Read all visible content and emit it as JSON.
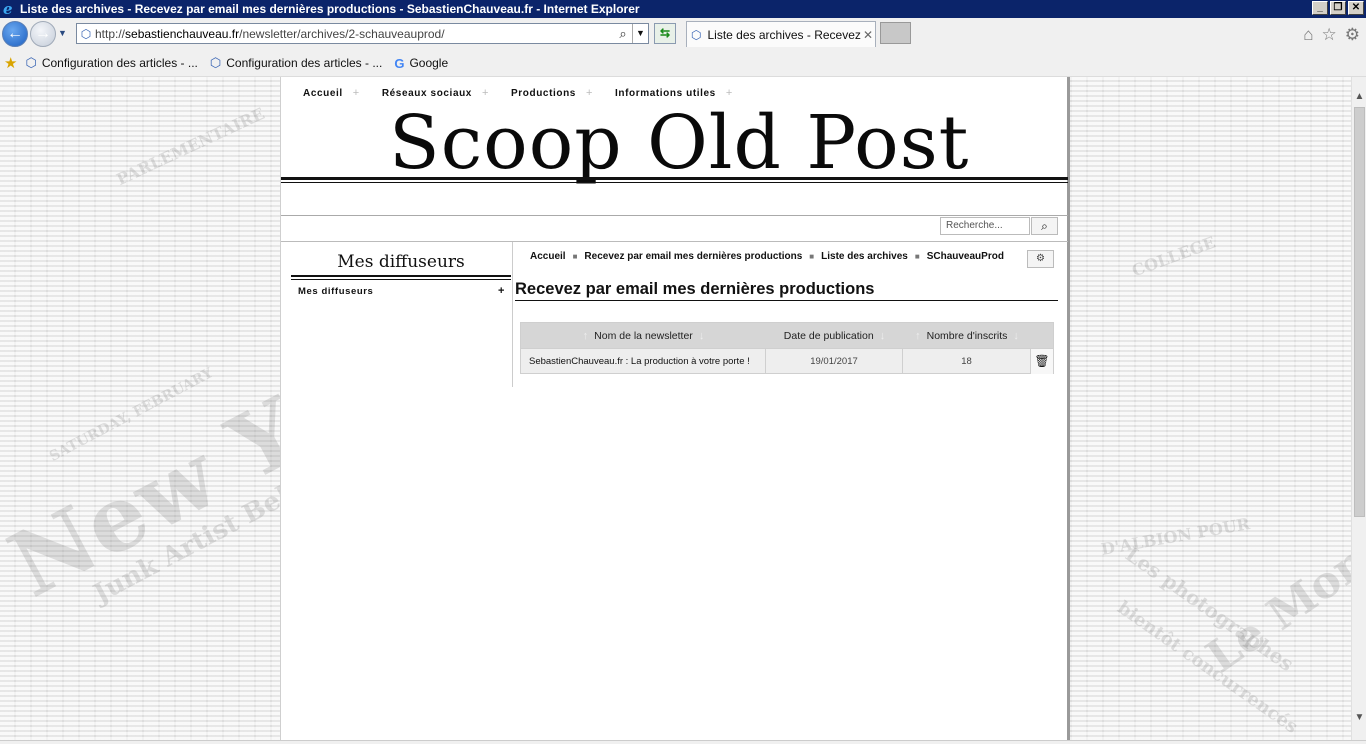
{
  "window": {
    "title": "Liste des archives - Recevez par email mes dernières productions - SebastienChauveau.fr - Internet Explorer"
  },
  "address_bar": {
    "url_prefix": "http://",
    "url_domain": "sebastienchauveau.fr",
    "url_path": "/newsletter/archives/2-schauveauprod/"
  },
  "tab": {
    "title": "Liste des archives - Recevez ..."
  },
  "favorites": [
    {
      "label": "Configuration des articles - ..."
    },
    {
      "label": "Configuration des articles - ..."
    },
    {
      "label": "Google"
    }
  ],
  "site": {
    "nav": [
      "Accueil",
      "Réseaux sociaux",
      "Productions",
      "Informations utiles"
    ],
    "masthead": "Scoop Old Post",
    "search_placeholder": "Recherche..."
  },
  "sidebar": {
    "title": "Mes diffuseurs",
    "link": "Mes diffuseurs"
  },
  "breadcrumb": [
    "Accueil",
    "Recevez par email mes dernières productions",
    "Liste des archives",
    "SChauveauProd"
  ],
  "main": {
    "title": "Recevez par email mes dernières productions"
  },
  "table": {
    "headers": [
      "Nom de la newsletter",
      "Date de publication",
      "Nombre d'inscrits"
    ],
    "rows": [
      {
        "name": "SebastienChauveau.fr : La production à votre porte !",
        "date": "19/01/2017",
        "subscribers": "18"
      }
    ]
  },
  "background_text": [
    "New York",
    "SATURDAY, FEBRUARY",
    "Junk Artist Behind",
    "PARLEMENTAIRE",
    "COLLEGE",
    "Le Monde",
    "Les photographes",
    "bientôt concurrencés",
    "D'ALBION POUR"
  ]
}
